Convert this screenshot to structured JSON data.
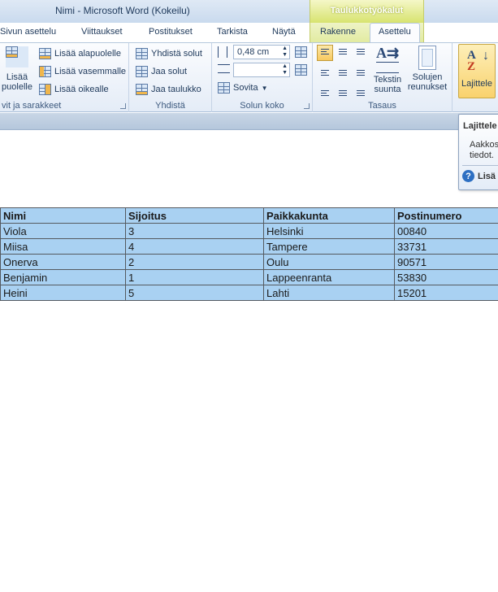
{
  "window": {
    "title": "Nimi  -  Microsoft Word (Kokeilu)",
    "contextual_group": "Taulukkotyökalut"
  },
  "tabs": [
    {
      "label": "Sivun asettelu"
    },
    {
      "label": "Viittaukset"
    },
    {
      "label": "Postitukset"
    },
    {
      "label": "Tarkista"
    },
    {
      "label": "Näytä"
    },
    {
      "label": "Rakenne"
    },
    {
      "label": "Asettelu",
      "active": true
    }
  ],
  "ribbon": {
    "rows_cols": {
      "insert_above_label": "Lisää\npuolelle",
      "insert_below": "Lisää alapuolelle",
      "insert_left": "Lisää vasemmalle",
      "insert_right": "Lisää oikealle",
      "group_label": "vit ja sarakkeet"
    },
    "merge": {
      "merge_cells": "Yhdistä solut",
      "split_cells": "Jaa solut",
      "split_table": "Jaa taulukko",
      "group_label": "Yhdistä"
    },
    "cell_size": {
      "height_value": "0,48 cm",
      "width_value": "",
      "autofit": "Sovita",
      "group_label": "Solun koko"
    },
    "alignment": {
      "text_direction": "Tekstin\nsuunta",
      "cell_margins": "Solujen\nreunukset",
      "group_label": "Tasaus"
    },
    "sort_label": "Lajittele"
  },
  "tooltip": {
    "title": "Lajittele",
    "line1": "Aakkos",
    "line2": "tiedot.",
    "help": "Lisä"
  },
  "table": {
    "headers": [
      "Nimi",
      "Sijoitus",
      "Paikkakunta",
      "Postinumero"
    ],
    "rows": [
      [
        "Viola",
        "3",
        "Helsinki",
        "00840"
      ],
      [
        "Miisa",
        "4",
        "Tampere",
        "33731"
      ],
      [
        "Onerva",
        "2",
        "Oulu",
        "90571"
      ],
      [
        "Benjamin",
        "1",
        "Lappeenranta",
        "53830"
      ],
      [
        "Heini",
        "5",
        "Lahti",
        "15201"
      ]
    ]
  },
  "colors": {
    "table_fill": "#a9d1f2",
    "selected_button": "#f9d26d",
    "contextual_tab": "#d7e36f"
  }
}
